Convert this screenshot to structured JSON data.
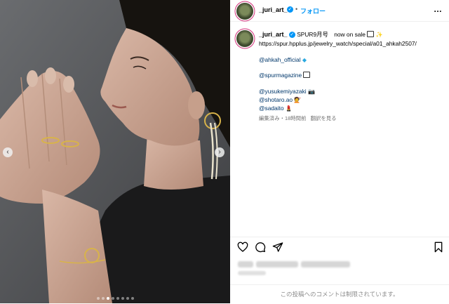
{
  "post": {
    "username": "_juri_art_",
    "follow_label": "フォロー",
    "header_separator": "•",
    "more_label": "…"
  },
  "caption": {
    "username": "_juri_art_",
    "text": "SPUR9月号　now on sale",
    "url": "https://spur.hpplus.jp/jewelry_watch/special/a01_ahkah2507/",
    "mentions": [
      "@ahkah_official",
      "@spurmagazine",
      "@yusukemiyazaki",
      "@shotaro.ao",
      "@sadaito"
    ],
    "meta_edited": "編集済み",
    "meta_time": "18時間前",
    "meta_separator": "・",
    "translate_label": "翻訳を見る"
  },
  "actions": {
    "like_icon": "heart-icon",
    "comment_icon": "comment-icon",
    "share_icon": "share-icon",
    "save_icon": "bookmark-icon"
  },
  "comments_restricted": "この投稿へのコメントは制限されています。",
  "carousel": {
    "prev_label": "‹",
    "next_label": "›",
    "slide_count": 8,
    "active_index": 2
  },
  "colors": {
    "accent": "#0095f6",
    "link": "#00376b",
    "muted": "#737373",
    "story_ring": "#d3317a"
  }
}
